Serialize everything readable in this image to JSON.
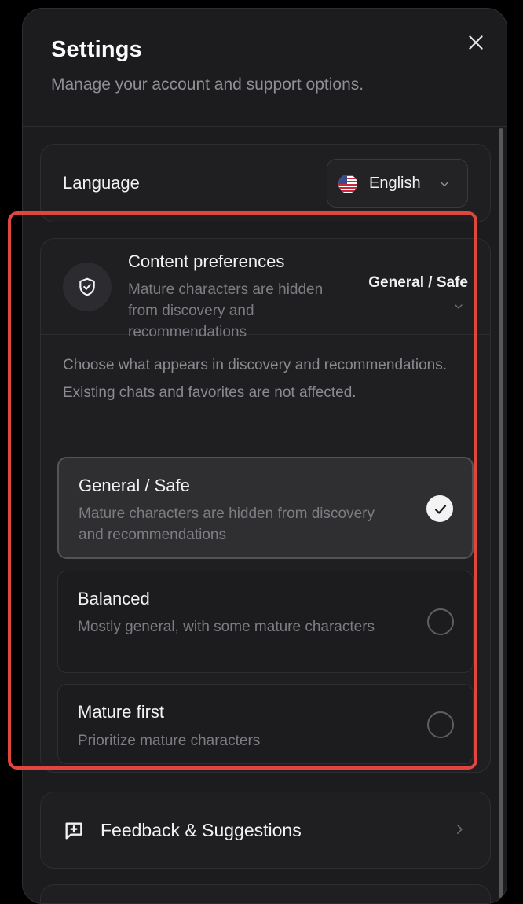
{
  "modal": {
    "title": "Settings",
    "subtitle": "Manage your account and support options."
  },
  "language": {
    "label": "Language",
    "value": "English",
    "flag": "us-flag-icon"
  },
  "content_preferences": {
    "title": "Content preferences",
    "description": "Mature characters are hidden from discovery and recommendations",
    "current_value": "General / Safe",
    "intro": "Choose what appears in discovery and recommendations. Existing chats and favorites are not affected.",
    "options": [
      {
        "label": "General / Safe",
        "description": "Mature characters are hidden from discovery and recommendations",
        "selected": true
      },
      {
        "label": "Balanced",
        "description": "Mostly general, with some mature characters",
        "selected": false
      },
      {
        "label": "Mature first",
        "description": "Prioritize mature characters",
        "selected": false
      }
    ]
  },
  "feedback": {
    "label": "Feedback & Suggestions",
    "icon": "message-plus-icon"
  },
  "colors": {
    "background": "#1c1c1e",
    "card": "#1f1f22",
    "highlight": "#e0463e",
    "selected_option": "#2f2f32"
  }
}
